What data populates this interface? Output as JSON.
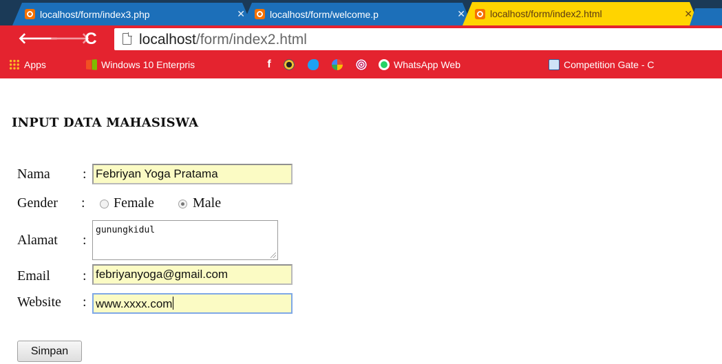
{
  "browser": {
    "tabs": [
      {
        "title": "localhost/form/index3.php",
        "active": false
      },
      {
        "title": "localhost/form/welcome.p",
        "active": false
      },
      {
        "title": "localhost/form/index2.html",
        "active": true
      }
    ],
    "close_glyph": "✕",
    "url_host": "localhost",
    "url_path": "/form/index2.html",
    "colors": {
      "tab_inactive": "#1c6fb9",
      "tab_active": "#ffd400",
      "toolbar": "#e4232f",
      "frame": "#1b3a57"
    }
  },
  "nav": {
    "back_glyph": "🡐",
    "forward_glyph": "🡒",
    "reload_glyph": "C"
  },
  "bookmarks": {
    "apps": "Apps",
    "windows": "Windows 10 Enterpris",
    "facebook_glyph": "f",
    "whatsapp": "WhatsApp Web",
    "competition": "Competition Gate - C"
  },
  "form": {
    "heading": "INPUT DATA MAHASISWA",
    "colon": ":",
    "nama_label": "Nama",
    "nama_value": "Febriyan Yoga Pratama",
    "gender_label": "Gender",
    "gender_options": [
      "Female",
      "Male"
    ],
    "gender_selected": "Male",
    "alamat_label": "Alamat",
    "alamat_value": "gunungkidul",
    "email_label": "Email",
    "email_value": "febriyanyoga@gmail.com",
    "website_label": "Website",
    "website_value": "www.xxxx.com",
    "submit_label": "Simpan",
    "input_bg": "#fbfbc4"
  }
}
